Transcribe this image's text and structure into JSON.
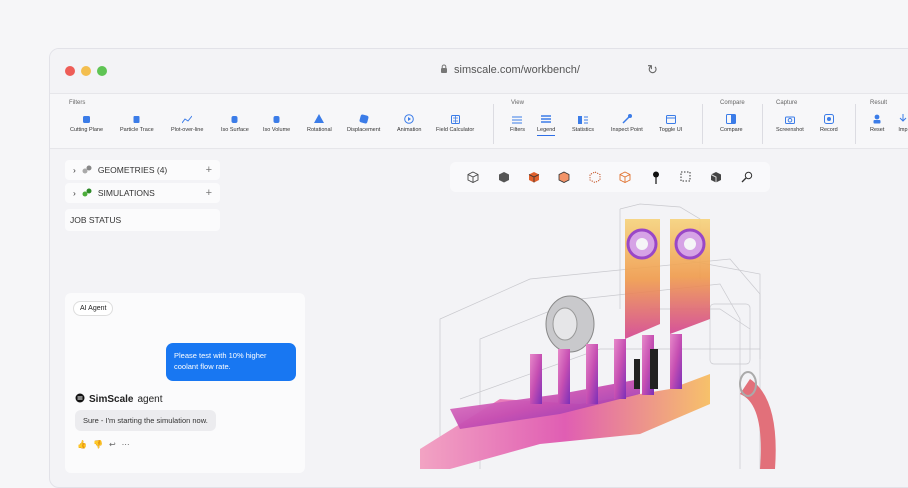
{
  "browser": {
    "url": "simscale.com/workbench/"
  },
  "ribbon": {
    "groups": {
      "filters": "Filters",
      "view": "View",
      "compare": "Compare",
      "capture": "Capture",
      "result": "Result"
    },
    "filters_tools": [
      "Cutting Plane",
      "Particle Trace",
      "Plot-over-line",
      "Iso Surface",
      "Iso Volume",
      "Rotational",
      "Displacement",
      "Animation",
      "Field Calculator"
    ],
    "view_tools": [
      "Filters",
      "Legend",
      "Statistics",
      "Inspect Point",
      "Toggle UI"
    ],
    "compare_tools": [
      "Compare"
    ],
    "capture_tools": [
      "Screenshot",
      "Record"
    ],
    "result_tools": [
      "Reset",
      "Imp"
    ]
  },
  "tree": {
    "geometries": "GEOMETRIES (4)",
    "simulations": "SIMULATIONS",
    "job_status": "JOB STATUS"
  },
  "agent": {
    "badge": "AI Agent",
    "user_message": "Please test with 10% higher coolant flow rate.",
    "brand": "SimScale",
    "brand_sub": "agent",
    "reply": "Sure - I'm starting the simulation now."
  },
  "colors": {
    "accent": "#1877f2",
    "heat_hot": "#f6c04a",
    "heat_mid": "#d3428f",
    "heat_cool": "#7b2fb8"
  }
}
